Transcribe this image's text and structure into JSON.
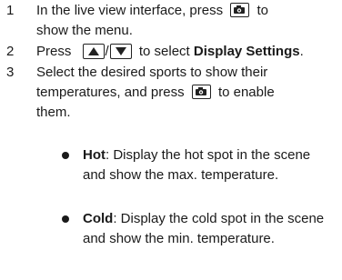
{
  "steps": [
    {
      "number": "1",
      "line1_before": "In the live view interface, press",
      "line1_after": "to",
      "line2": "show the menu.",
      "icon": "ok-camera-key-icon"
    },
    {
      "number": "2",
      "before": "Press",
      "separator": "/",
      "mid": "to select",
      "bold": "Display Settings",
      "end": ".",
      "icons": [
        "up-arrow-key-icon",
        "down-arrow-key-icon"
      ]
    },
    {
      "number": "3",
      "line1": "Select the desired sports to show their",
      "line2_before": "temperatures, and press",
      "line2_after": "to enable",
      "line3": "them.",
      "icon": "ok-camera-key-icon"
    }
  ],
  "bullets": [
    {
      "term": "Hot",
      "line1_rest": ": Display the hot spot in the scene",
      "line2": "and show the max. temperature."
    },
    {
      "term": "Cold",
      "line1_rest": ": Display the cold spot in the scene",
      "line2": "and show the min. temperature."
    }
  ]
}
